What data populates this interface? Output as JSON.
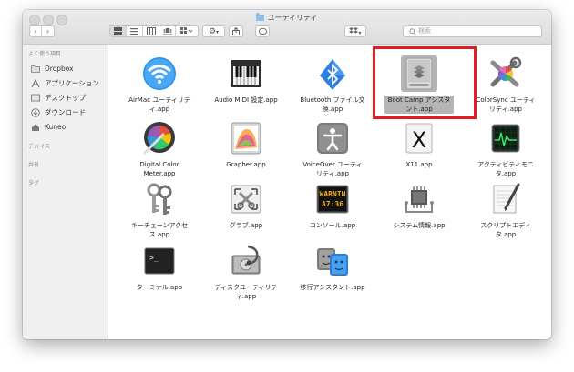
{
  "window": {
    "title": "ユーティリティ"
  },
  "toolbar": {
    "back_label": "‹",
    "forward_label": "›",
    "search_placeholder": "検索"
  },
  "sidebar": {
    "favorites_header": "よく使う項目",
    "items": [
      {
        "label": "Dropbox"
      },
      {
        "label": "アプリケーション"
      },
      {
        "label": "デスクトップ"
      },
      {
        "label": "ダウンロード"
      },
      {
        "label": "Kuneo"
      }
    ],
    "devices_header": "デバイス",
    "shared_header": "共有",
    "tags_header": "タグ"
  },
  "apps": [
    {
      "line1": "AirMac ユーティリテ",
      "line2": "ィ.app"
    },
    {
      "line1": "Audio MIDI 設定.app",
      "line2": ""
    },
    {
      "line1": "Bluetooth ファイル交",
      "line2": "換.app"
    },
    {
      "line1": "Boot Camp アシスタ",
      "line2": "ント.app"
    },
    {
      "line1": "ColorSync ユーティ",
      "line2": "リティ.app"
    },
    {
      "line1": "Digital Color",
      "line2": "Meter.app"
    },
    {
      "line1": "Grapher.app",
      "line2": ""
    },
    {
      "line1": "VoiceOver ユーティ",
      "line2": "リティ.app"
    },
    {
      "line1": "X11.app",
      "line2": ""
    },
    {
      "line1": "アクティビティモニ",
      "line2": "タ.app"
    },
    {
      "line1": "キーチェーンアクセ",
      "line2": "ス.app"
    },
    {
      "line1": "グラブ.app",
      "line2": ""
    },
    {
      "line1": "コンソール.app",
      "line2": ""
    },
    {
      "line1": "システム情報.app",
      "line2": ""
    },
    {
      "line1": "スクリプトエディ",
      "line2": "タ.app"
    },
    {
      "line1": "ターミナル.app",
      "line2": ""
    },
    {
      "line1": "ディスクユーティリテ",
      "line2": "ィ.app"
    },
    {
      "line1": "移行アシスタント.app",
      "line2": ""
    }
  ],
  "console_icon_text": [
    "WARNIN",
    "A7:36"
  ],
  "terminal_icon_text": ">_",
  "x11_icon_text": "X",
  "colors": {
    "selection": "#b5b5b5",
    "highlight_border": "#e31b23",
    "sidebar_bg": "#f0f0f0"
  }
}
